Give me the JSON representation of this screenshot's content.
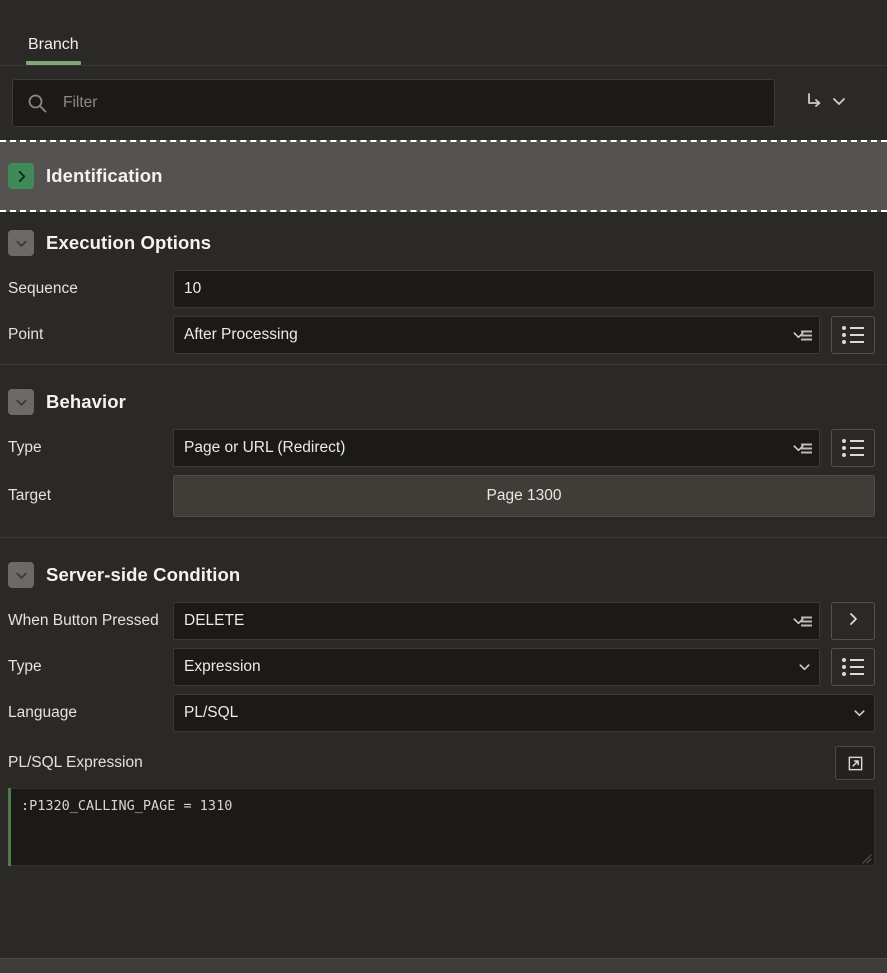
{
  "tabs": [
    {
      "label": "Branch",
      "active": true
    }
  ],
  "search": {
    "placeholder": "Filter",
    "value": "",
    "icon": "search-icon",
    "actions_icon": "arrow-turn-down-right-icon",
    "actions_chevron": "chevron-down-icon"
  },
  "colors": {
    "accent_green": "#7ea878",
    "toggle_green": "#3f8a58",
    "highlight_band": "#55534f",
    "page_bg": "#2b2927",
    "field_bg": "#1b1a18",
    "code_accent": "#4f7a4a"
  },
  "groups": [
    {
      "id": "identification",
      "title": "Identification",
      "collapsed": true,
      "highlighted": true,
      "toggle_icon": "chevron-right-icon"
    },
    {
      "id": "execution-options",
      "title": "Execution Options",
      "collapsed": false,
      "toggle_icon": "chevron-down-icon",
      "fields": [
        {
          "name": "sequence",
          "label": "Sequence",
          "control": "text",
          "value": "10"
        },
        {
          "name": "point",
          "label": "Point",
          "control": "select-lov",
          "value": "After Processing",
          "button_icon": "list-icon"
        }
      ]
    },
    {
      "id": "behavior",
      "title": "Behavior",
      "collapsed": false,
      "toggle_icon": "chevron-down-icon",
      "fields": [
        {
          "name": "type",
          "label": "Type",
          "control": "select-lov",
          "value": "Page or URL (Redirect)",
          "button_icon": "list-icon"
        },
        {
          "name": "target",
          "label": "Target",
          "control": "button",
          "value": "Page 1300"
        }
      ]
    },
    {
      "id": "server-side-condition",
      "title": "Server-side Condition",
      "collapsed": false,
      "toggle_icon": "chevron-down-icon",
      "fields": [
        {
          "name": "when-button-pressed",
          "label": "When Button Pressed",
          "control": "select-lov",
          "value": "DELETE",
          "button_icon": "chevron-right-icon"
        },
        {
          "name": "condition-type",
          "label": "Type",
          "control": "select",
          "value": "Expression",
          "button_icon": "list-icon"
        },
        {
          "name": "language",
          "label": "Language",
          "control": "select-plain",
          "value": "PL/SQL"
        }
      ],
      "code": {
        "name": "plsql-expression",
        "label": "PL/SQL Expression",
        "value": ":P1320_CALLING_PAGE = 1310",
        "expand_icon": "expand-external-icon"
      }
    }
  ]
}
